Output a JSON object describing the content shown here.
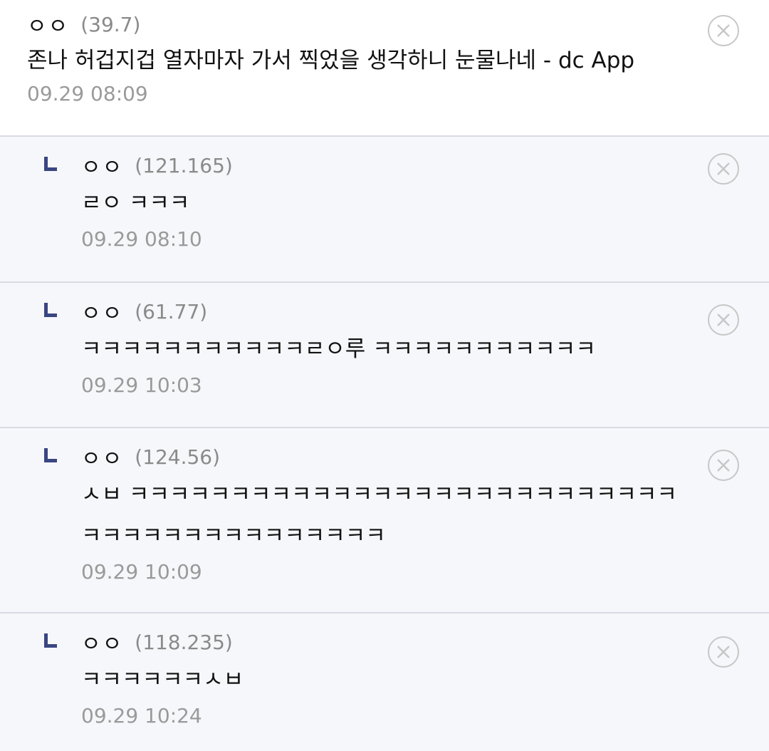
{
  "comments": [
    {
      "nick": "ㅇㅇ",
      "ip": "(39.7)",
      "text": "존나 허겁지겁 열자마자 가서 찍었을 생각하니 눈물나네 - dc App",
      "time": "09.29 08:09"
    }
  ],
  "replies": [
    {
      "mark": "ㄴ",
      "nick": "ㅇㅇ",
      "ip": "(121.165)",
      "text": "ㄹㅇ ㅋㅋㅋ",
      "time": "09.29 08:10"
    },
    {
      "mark": "ㄴ",
      "nick": "ㅇㅇ",
      "ip": "(61.77)",
      "text": "ㅋㅋㅋㅋㅋㅋㅋㅋㅋㅋㅋㄹㅇ루 ㅋㅋㅋㅋㅋㅋㅋㅋㅋㅋㅋ",
      "time": "09.29 10:03"
    },
    {
      "mark": "ㄴ",
      "nick": "ㅇㅇ",
      "ip": "(124.56)",
      "text_line1": "ㅅㅂ ㅋㅋㅋㅋㅋㅋㅋㅋㅋㅋㅋㅋㅋㅋㅋㅋㅋㅋㅋㅋㅋㅋㅋㅋㅋㅋㅋ",
      "text_line2": "ㅋㅋㅋㅋㅋㅋㅋㅋㅋㅋㅋㅋㅋㅋㅋ",
      "time": "09.29 10:09"
    },
    {
      "mark": "ㄴ",
      "nick": "ㅇㅇ",
      "ip": "(118.235)",
      "text": "ㅋㅋㅋㅋㅋㅋㅅㅂ",
      "time": "09.29 10:24"
    }
  ],
  "icons": {
    "delete": "close-circle-icon",
    "reply": "reply-indicator-icon"
  },
  "colors": {
    "reply_background": "#f6f7fa",
    "reply_mark": "#3a4680",
    "meta_text": "#8a8a8a",
    "divider": "#d9dbe3"
  }
}
